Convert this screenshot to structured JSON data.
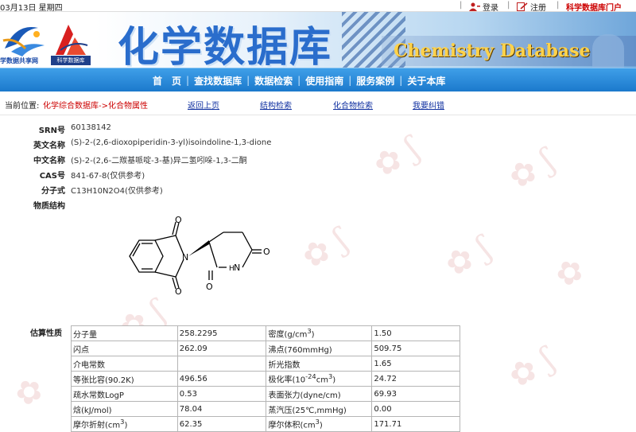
{
  "topbar": {
    "date": "03月13日 星期四",
    "login": "登录",
    "register": "注册",
    "portal": "科学数据库门户"
  },
  "header": {
    "logo1_text": "学数据共享网",
    "logo2_text": "科学数据库",
    "title_cn": "化学数据库",
    "title_en": "Chemistry Database"
  },
  "nav": {
    "items": [
      "首　页",
      "查找数据库",
      "数据检索",
      "使用指南",
      "服务案例",
      "关于本库"
    ]
  },
  "breadcrumb": {
    "label": "当前位置:",
    "path": "化学综合数据库->化合物属性",
    "back": "返回上页",
    "structure_search": "结构检索",
    "compound_search": "化合物检索",
    "report_error": "我要纠错"
  },
  "compound": {
    "srn_label": "SRN号",
    "srn": "60138142",
    "en_name_label": "英文名称",
    "en_name": "(S)-2-(2,6-dioxopiperidin-3-yl)isoindoline-1,3-dione",
    "cn_name_label": "中文名称",
    "cn_name": "(S)-2-(2,6-二羰基哌啶-3-基)异二氢吲哚-1,3-二酮",
    "cas_label": "CAS号",
    "cas": "841-67-8(仅供参考)",
    "formula_label": "分子式",
    "formula": "C13H10N2O4(仅供参考)",
    "structure_label": "物质结构",
    "atom_o": "O",
    "atom_n": "N"
  },
  "properties": {
    "label": "估算性质",
    "rows": [
      {
        "k1": "分子量",
        "v1": "258.2295",
        "k2_pre": "密度(g/cm",
        "k2_sup": "3",
        "k2_post": ")",
        "v2": "1.50"
      },
      {
        "k1": "闪点",
        "v1": "262.09",
        "k2_pre": "沸点(760mmHg)",
        "k2_sup": "",
        "k2_post": "",
        "v2": "509.75"
      },
      {
        "k1": "介电常数",
        "v1": "",
        "k2_pre": "折光指数",
        "k2_sup": "",
        "k2_post": "",
        "v2": "1.65"
      },
      {
        "k1": "等张比容(90.2K)",
        "v1": "496.56",
        "k2_pre": "极化率(10",
        "k2_sup": "-24",
        "k2_mid": "cm",
        "k2_sup2": "3",
        "k2_post": ")",
        "v2": "24.72"
      },
      {
        "k1": "疏水常数LogP",
        "v1": "0.53",
        "k2_pre": "表面张力(dyne/cm)",
        "k2_sup": "",
        "k2_post": "",
        "v2": "69.93"
      },
      {
        "k1": "焓(kJ/mol)",
        "v1": "78.04",
        "k2_pre": "蒸汽压(25℃,mmHg)",
        "k2_sup": "",
        "k2_post": "",
        "v2": "0.00"
      },
      {
        "k1_pre": "摩尔折射(cm",
        "k1_sup": "3",
        "k1_post": ")",
        "v1": "62.35",
        "k2_pre": "摩尔体积(cm",
        "k2_sup": "3",
        "k2_post": ")",
        "v2": "171.71"
      }
    ]
  }
}
